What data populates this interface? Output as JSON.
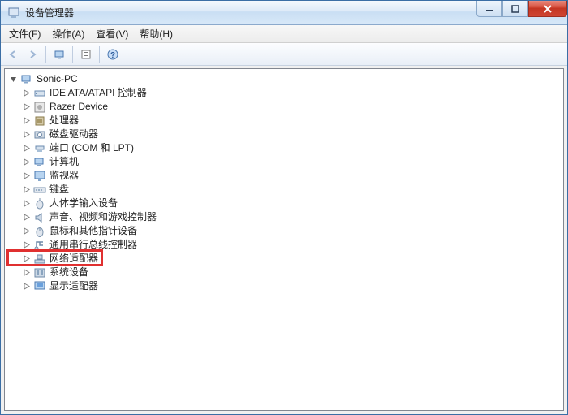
{
  "window": {
    "title": "设备管理器"
  },
  "menus": {
    "file": "文件(F)",
    "action": "操作(A)",
    "view": "查看(V)",
    "help": "帮助(H)"
  },
  "root": {
    "label": "Sonic-PC"
  },
  "items": [
    {
      "label": "IDE ATA/ATAPI 控制器",
      "icon": "ide"
    },
    {
      "label": "Razer Device",
      "icon": "razer"
    },
    {
      "label": "处理器",
      "icon": "cpu"
    },
    {
      "label": "磁盘驱动器",
      "icon": "disk"
    },
    {
      "label": "端口 (COM 和 LPT)",
      "icon": "port"
    },
    {
      "label": "计算机",
      "icon": "computer"
    },
    {
      "label": "监视器",
      "icon": "monitor"
    },
    {
      "label": "键盘",
      "icon": "keyboard"
    },
    {
      "label": "人体学输入设备",
      "icon": "hid"
    },
    {
      "label": "声音、视频和游戏控制器",
      "icon": "sound"
    },
    {
      "label": "鼠标和其他指针设备",
      "icon": "mouse"
    },
    {
      "label": "通用串行总线控制器",
      "icon": "usb"
    },
    {
      "label": "网络适配器",
      "icon": "network",
      "highlighted": true
    },
    {
      "label": "系统设备",
      "icon": "system"
    },
    {
      "label": "显示适配器",
      "icon": "display"
    }
  ],
  "highlight_color": "#e03030"
}
